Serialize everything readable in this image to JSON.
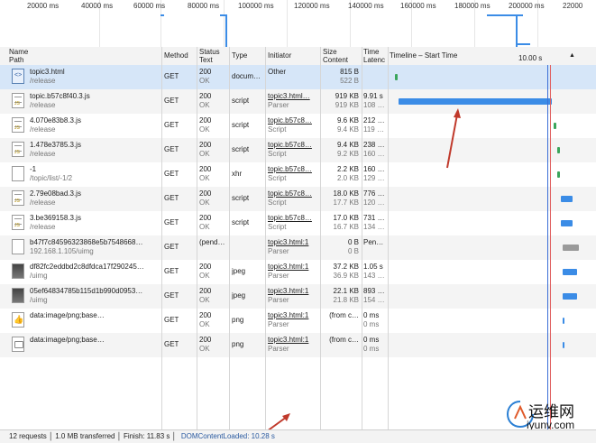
{
  "overview": {
    "ticks": [
      "20000 ms",
      "40000 ms",
      "60000 ms",
      "80000 ms",
      "100000 ms",
      "120000 ms",
      "140000 ms",
      "160000 ms",
      "180000 ms",
      "200000 ms",
      "22000"
    ]
  },
  "columns": {
    "name": "Name",
    "path": "Path",
    "method": "Method",
    "status": "Status",
    "text": "Text",
    "type": "Type",
    "initiator": "Initiator",
    "size": "Size",
    "content": "Content",
    "time": "Time",
    "latency": "Latenc",
    "timeline": "Timeline – Start Time",
    "marker": "10.00 s",
    "sort_icon": "triangle-up-icon"
  },
  "rows": [
    {
      "icon": "html",
      "name": "topic3.html",
      "path": "/release",
      "method": "GET",
      "status": "200",
      "text": "OK",
      "type": "docum…",
      "init1": "Other",
      "init2": "",
      "size": "815 B",
      "content": "522 B",
      "time": "",
      "latency": ""
    },
    {
      "icon": "js",
      "name": "topic.b57c8f40.3.js",
      "path": "/release",
      "method": "GET",
      "status": "200",
      "text": "OK",
      "type": "script",
      "init1": "topic3.html…",
      "init2": "Parser",
      "size": "919 KB",
      "content": "919 KB",
      "time": "9.91 s",
      "latency": "108 …"
    },
    {
      "icon": "js",
      "name": "4.070e83b8.3.js",
      "path": "/release",
      "method": "GET",
      "status": "200",
      "text": "OK",
      "type": "script",
      "init1": "topic.b57c8…",
      "init2": "Script",
      "size": "9.6 KB",
      "content": "9.4 KB",
      "time": "212 …",
      "latency": "119 …"
    },
    {
      "icon": "js",
      "name": "1.478e3785.3.js",
      "path": "/release",
      "method": "GET",
      "status": "200",
      "text": "OK",
      "type": "script",
      "init1": "topic.b57c8…",
      "init2": "Script",
      "size": "9.4 KB",
      "content": "9.2 KB",
      "time": "238 …",
      "latency": "160 …"
    },
    {
      "icon": "blank",
      "name": "-1",
      "path": "/topic/list/-1/2",
      "method": "GET",
      "status": "200",
      "text": "OK",
      "type": "xhr",
      "init1": "topic.b57c8…",
      "init2": "Script",
      "size": "2.2 KB",
      "content": "2.0 KB",
      "time": "160 …",
      "latency": "129 …"
    },
    {
      "icon": "js",
      "name": "2.79e08bad.3.js",
      "path": "/release",
      "method": "GET",
      "status": "200",
      "text": "OK",
      "type": "script",
      "init1": "topic.b57c8…",
      "init2": "Script",
      "size": "18.0 KB",
      "content": "17.7 KB",
      "time": "776 …",
      "latency": "120 …"
    },
    {
      "icon": "js",
      "name": "3.be369158.3.js",
      "path": "/release",
      "method": "GET",
      "status": "200",
      "text": "OK",
      "type": "script",
      "init1": "topic.b57c8…",
      "init2": "Script",
      "size": "17.0 KB",
      "content": "16.7 KB",
      "time": "731 …",
      "latency": "134 …"
    },
    {
      "icon": "blank",
      "name": "b47f7c84596323868e5b7548668…",
      "path": "192.168.1.105/uimg",
      "method": "GET",
      "status": "(pend…",
      "text": "",
      "type": "",
      "init1": "topic3.html:1",
      "init2": "Parser",
      "size": "0 B",
      "content": "0 B",
      "time": "Pen…",
      "latency": ""
    },
    {
      "icon": "img",
      "name": "df82fc2eddbd2c8dfdca17f290245…",
      "path": "/uimg",
      "method": "GET",
      "status": "200",
      "text": "OK",
      "type": "jpeg",
      "init1": "topic3.html:1",
      "init2": "Parser",
      "size": "37.2 KB",
      "content": "36.9 KB",
      "time": "1.05 s",
      "latency": "143 …"
    },
    {
      "icon": "img",
      "name": "05ef64834785b115d1b990d0953…",
      "path": "/uimg",
      "method": "GET",
      "status": "200",
      "text": "OK",
      "type": "jpeg",
      "init1": "topic3.html:1",
      "init2": "Parser",
      "size": "22.1 KB",
      "content": "21.8 KB",
      "time": "893 …",
      "latency": "154 …"
    },
    {
      "icon": "like",
      "name": "data:image/png;base…",
      "path": "",
      "method": "GET",
      "status": "200",
      "text": "OK",
      "type": "png",
      "init1": "topic3.html:1",
      "init2": "Parser",
      "size": "(from c…",
      "content": "",
      "time": "0 ms",
      "latency": "0 ms"
    },
    {
      "icon": "chat",
      "name": "data:image/png;base…",
      "path": "",
      "method": "GET",
      "status": "200",
      "text": "OK",
      "type": "png",
      "init1": "topic3.html:1",
      "init2": "Parser",
      "size": "(from c…",
      "content": "",
      "time": "0 ms",
      "latency": "0 ms"
    }
  ],
  "status_bar": {
    "summary": "12 requests │ 1.0 MB transferred │ Finish: 11.83 s │",
    "dom_loaded": "DOMContentLoaded: 10.28 s"
  },
  "watermark": {
    "cn": "运维网",
    "url": "iyunv.com"
  },
  "colors": {
    "accent": "#3b8ce6",
    "annotation": "#c0392b",
    "selected": "#d6e6f8"
  }
}
